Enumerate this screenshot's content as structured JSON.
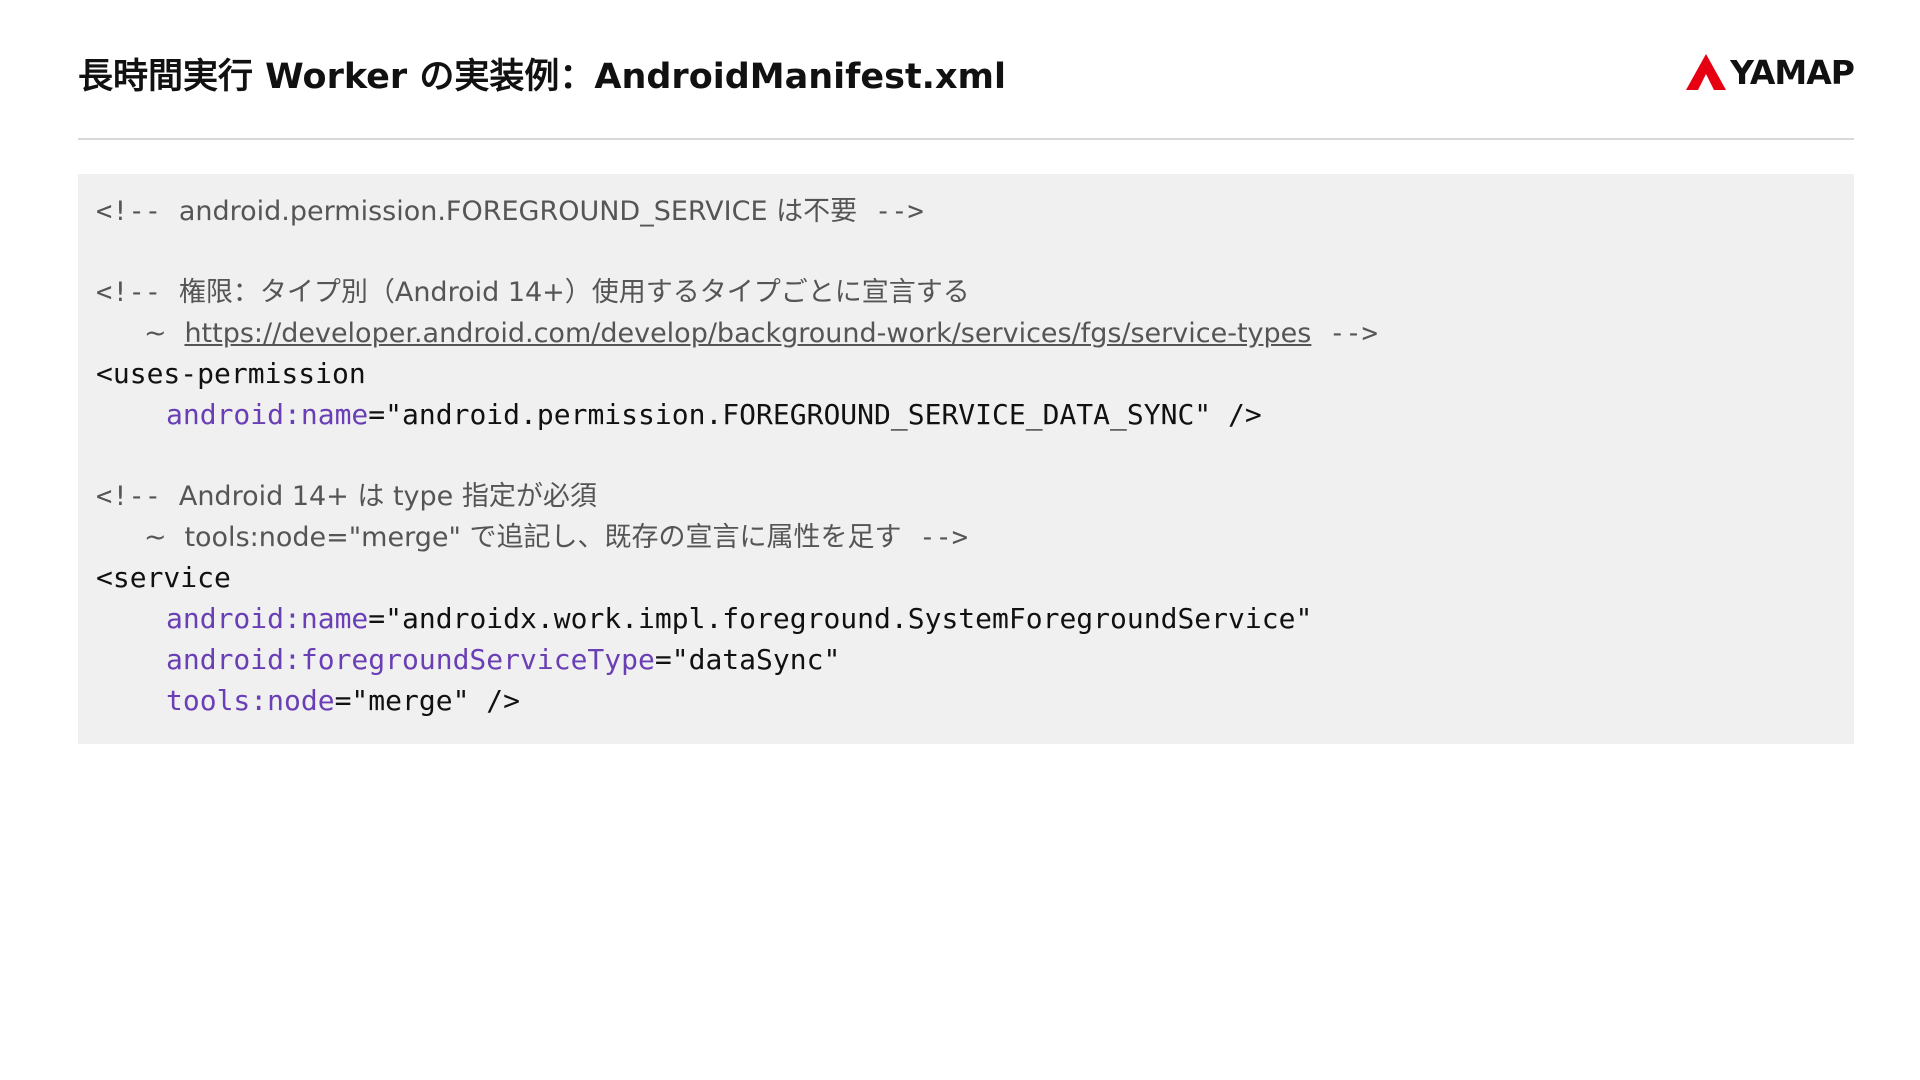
{
  "header": {
    "title": "長時間実行 Worker の実装例：AndroidManifest.xml",
    "logo_text": "YAMAP",
    "logo_color": "#e60012"
  },
  "code": {
    "comment_open": "<!--",
    "comment_close": "-->",
    "continuation": "~",
    "c1_text": "android.permission.FOREGROUND_SERVICE は不要",
    "c2_text": "権限：タイプ別（Android 14+）使用するタイプごとに宣言する",
    "c2_link": "https://developer.android.com/develop/background-work/services/fgs/service-types",
    "uses_permission_tag": "<uses-permission",
    "perm_attr": "android:name",
    "perm_value": "=\"android.permission.FOREGROUND_SERVICE_DATA_SYNC\" />",
    "c3_text": "Android 14+ は type 指定が必須",
    "c3_cont": "tools:node=\"merge\" で追記し、既存の宣言に属性を足す",
    "service_tag": "<service",
    "svc_name_attr": "android:name",
    "svc_name_value": "=\"androidx.work.impl.foreground.SystemForegroundService\"",
    "svc_type_attr": "android:foregroundServiceType",
    "svc_type_value": "=\"dataSync\"",
    "svc_node_attr": "tools:node",
    "svc_node_value": "=\"merge\" />"
  }
}
